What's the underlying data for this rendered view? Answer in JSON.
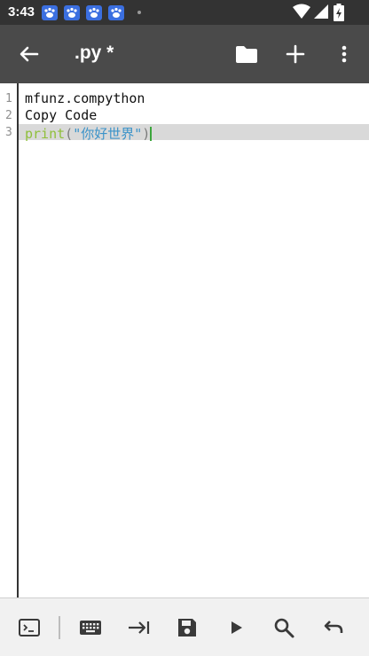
{
  "status_bar": {
    "time": "3:43",
    "icons": [
      "baidu-app-icon",
      "baidu-app-icon",
      "baidu-app-icon",
      "baidu-app-icon",
      "wifi-icon",
      "signal-icon",
      "battery-icon"
    ]
  },
  "app_bar": {
    "title": ".py *",
    "actions": [
      "back-arrow-icon",
      "folder-icon",
      "add-icon",
      "more-vert-icon"
    ]
  },
  "editor": {
    "line_numbers": [
      "1",
      "2",
      "3"
    ],
    "lines": [
      {
        "text": "mfunz.compython"
      },
      {
        "text": "Copy Code"
      },
      {
        "keyword": "print",
        "open": "(",
        "string": "\"你好世界\"",
        "close": ")"
      }
    ]
  },
  "bottom_bar": {
    "actions": [
      "terminal-icon",
      "keyboard-icon",
      "tab-icon",
      "save-icon",
      "run-icon",
      "search-icon",
      "undo-icon"
    ]
  },
  "colors": {
    "status_bar": "#333333",
    "app_bar": "#4a4a4a",
    "keyword": "#8fbf3a",
    "string": "#3b93c9",
    "caret": "#3da63d"
  }
}
